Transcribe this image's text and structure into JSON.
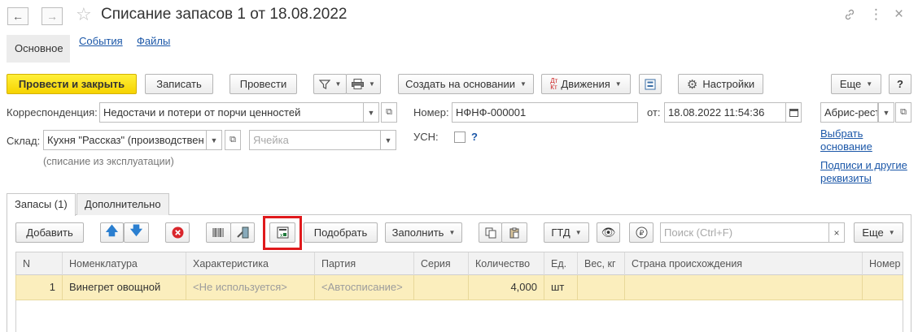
{
  "window": {
    "title": "Списание запасов 1 от 18.08.2022",
    "back_icon": "←",
    "forward_icon": "→",
    "favorite_icon": "☆",
    "link_icon": "🔗",
    "menu_icon": "⋮",
    "close_icon": "×"
  },
  "nav_tabs": [
    "Основное",
    "События",
    "Файлы"
  ],
  "toolbar": {
    "post_close": "Провести и закрыть",
    "save": "Записать",
    "post": "Провести",
    "create_based_on": "Создать на основании",
    "movements": "Движения",
    "settings": "Настройки",
    "more": "Еще",
    "help": "?"
  },
  "form": {
    "corr_label": "Корреспонденция:",
    "corr_value": "Недостачи и потери от порчи ценностей",
    "number_label": "Номер:",
    "number_value": "НФНФ-000001",
    "date_label": "от:",
    "date_value": "18.08.2022 11:54:36",
    "org_value": "Абрис-рест",
    "warehouse_label": "Склад:",
    "warehouse_value": "Кухня \"Рассказ\" (производствен",
    "cell_placeholder": "Ячейка",
    "usn_label": "УСН:",
    "usn_help": "?",
    "writeoff_note": "(списание из эксплуатации)",
    "select_basis_line1": "Выбрать",
    "select_basis_line2": "основание",
    "signatures_line1": "Подписи и другие",
    "signatures_line2": "реквизиты"
  },
  "page_tabs": [
    "Запасы (1)",
    "Дополнительно"
  ],
  "table_toolbar": {
    "add": "Добавить",
    "pick": "Подобрать",
    "fill": "Заполнить",
    "gtd": "ГТД",
    "search_placeholder": "Поиск (Ctrl+F)",
    "more": "Еще"
  },
  "table": {
    "columns": [
      "N",
      "Номенклатура",
      "Характеристика",
      "Партия",
      "Серия",
      "Количество",
      "Ед.",
      "Вес, кг",
      "Страна происхождения",
      "Номер"
    ],
    "rows": [
      {
        "n": "1",
        "item": "Винегрет овощной",
        "characteristic": "<Не используется>",
        "batch": "<Автосписание>",
        "series": "",
        "qty": "4,000",
        "unit": "шт",
        "weight": "",
        "country": "",
        "number": ""
      }
    ]
  },
  "colors": {
    "primary_button": "#f6d300",
    "selected_row": "#fbeebd",
    "link": "#1b57a8",
    "highlight_frame": "#e0191c"
  }
}
